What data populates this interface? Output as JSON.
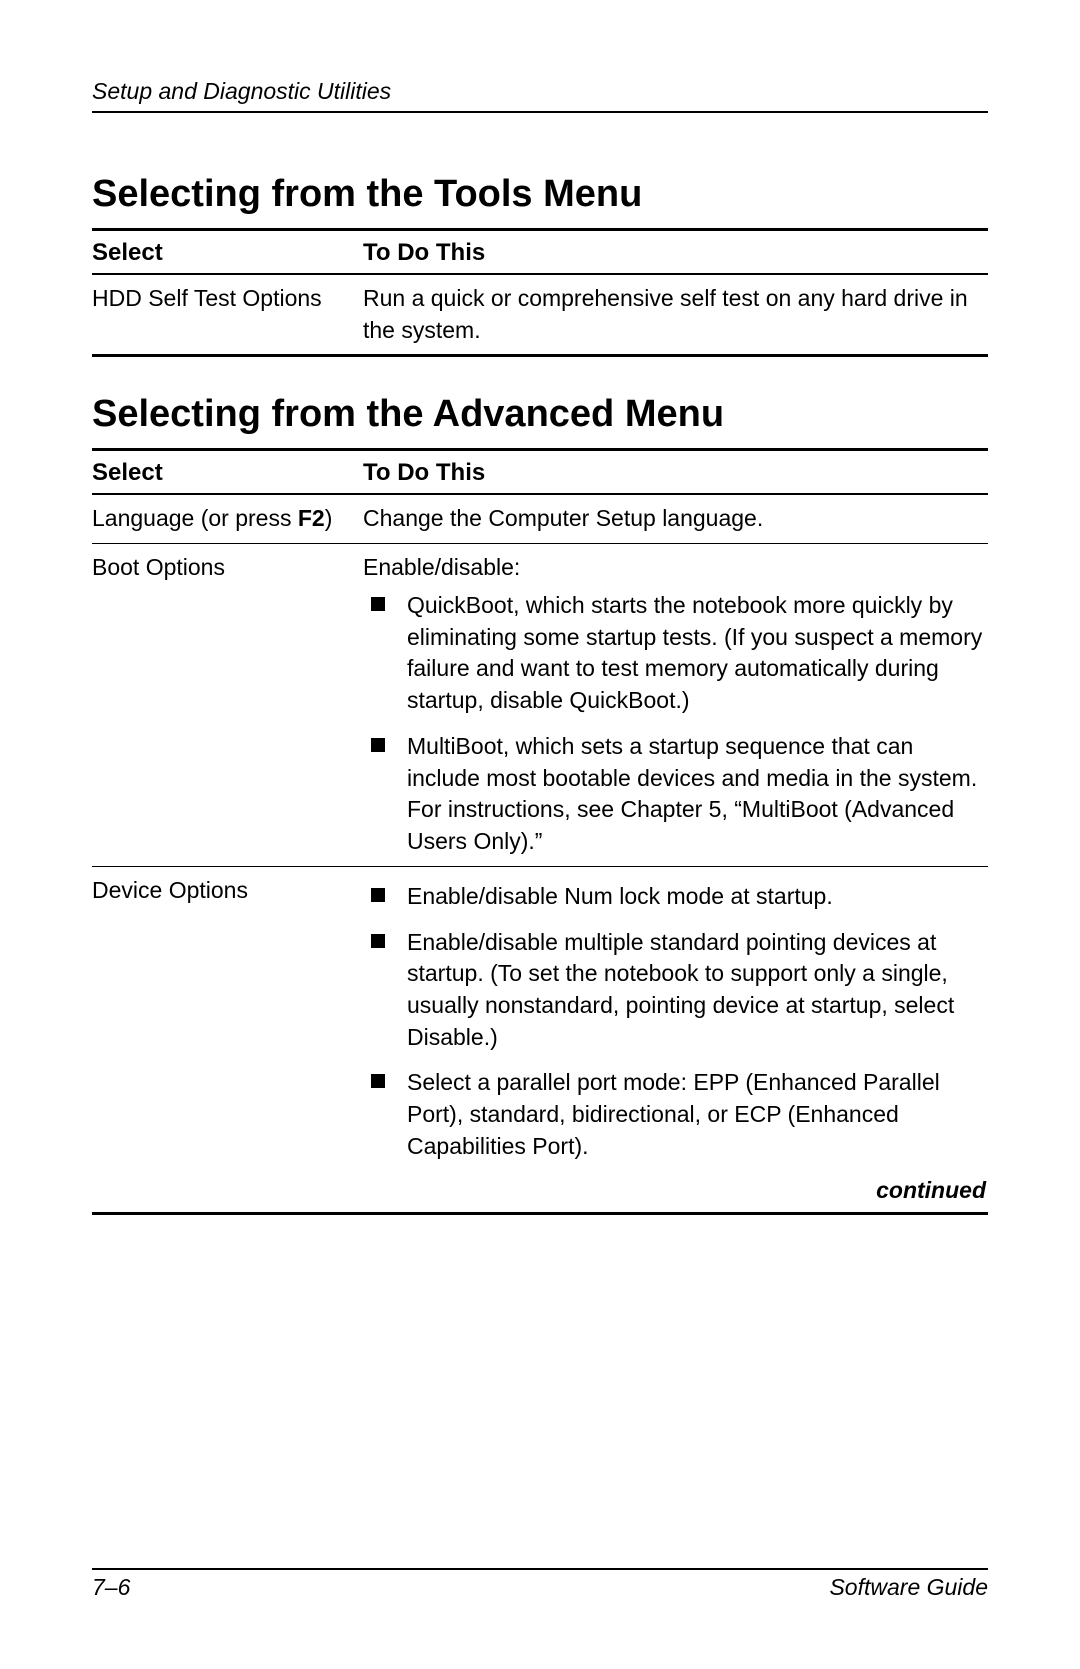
{
  "header": {
    "running": "Setup and Diagnostic Utilities"
  },
  "sections": {
    "tools": {
      "title": "Selecting from the Tools Menu",
      "columns": {
        "select": "Select",
        "todo": "To Do This"
      },
      "rows": {
        "hdd": {
          "select": "HDD Self Test Options",
          "todo": "Run a quick or comprehensive self test on any hard drive in the system."
        }
      }
    },
    "advanced": {
      "title": "Selecting from the Advanced Menu",
      "columns": {
        "select": "Select",
        "todo": "To Do This"
      },
      "rows": {
        "language": {
          "select_pre": "Language (or press ",
          "select_key": "F2",
          "select_post": ")",
          "todo": "Change the Computer Setup language."
        },
        "boot": {
          "select": "Boot Options",
          "intro": "Enable/disable:",
          "items": {
            "quickboot": "QuickBoot, which starts the notebook more quickly by eliminating some startup tests. (If you suspect a memory failure and want to test memory automatically during startup, disable QuickBoot.)",
            "multiboot": "MultiBoot, which sets a startup sequence that can include most bootable devices and media in the system. For instructions, see Chapter 5, “MultiBoot (Advanced Users Only).”"
          }
        },
        "device": {
          "select": "Device Options",
          "items": {
            "numlock": "Enable/disable Num lock mode at startup.",
            "pointing": "Enable/disable multiple standard pointing devices at startup. (To set the notebook to support only a single, usually nonstandard, pointing device at startup, select Disable.)",
            "parallel": "Select a parallel port mode: EPP (Enhanced Parallel Port), standard, bidirectional, or ECP (Enhanced Capabilities Port)."
          }
        }
      },
      "continued": "continued"
    }
  },
  "footer": {
    "page": "7–6",
    "guide": "Software Guide"
  }
}
